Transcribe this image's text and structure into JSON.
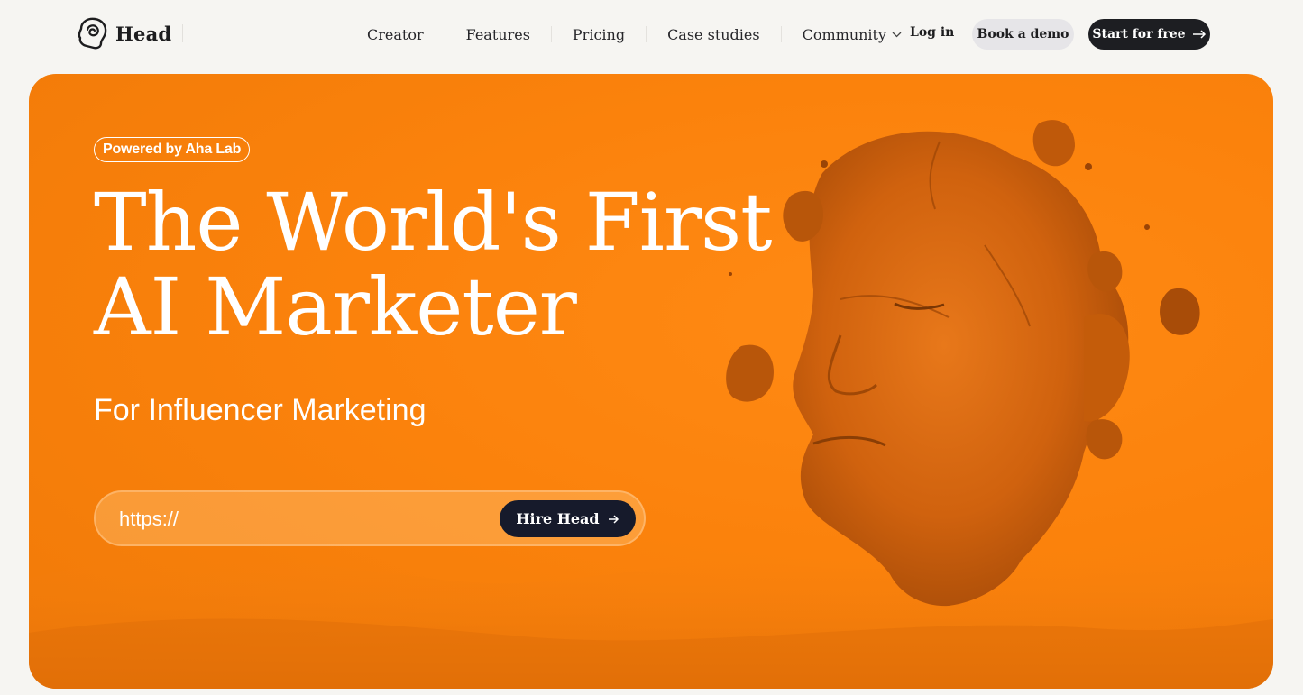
{
  "brand": {
    "name": "Head",
    "icon": "head-logo-icon"
  },
  "nav": {
    "items": [
      {
        "label": "Creator"
      },
      {
        "label": "Features"
      },
      {
        "label": "Pricing"
      },
      {
        "label": "Case studies"
      },
      {
        "label": "Community",
        "icon": "chevron-down-icon"
      }
    ],
    "login": "Log in",
    "book_demo": "Book a demo",
    "start_free": "Start for free"
  },
  "hero": {
    "badge": "Powered by Aha Lab",
    "headline_line1": "The World's First",
    "headline_line2": "AI Marketer",
    "subheadline": "For Influencer Marketing",
    "url_placeholder": "https://",
    "hire_button": "Hire Head",
    "image": "stone-head-sculpture-in-desert"
  },
  "colors": {
    "hero_orange": "#fb820c",
    "dark_button": "#1d1e22",
    "hire_button": "#161a2b",
    "demo_button": "#e6e5e8",
    "page_background": "#f6f5f2"
  }
}
